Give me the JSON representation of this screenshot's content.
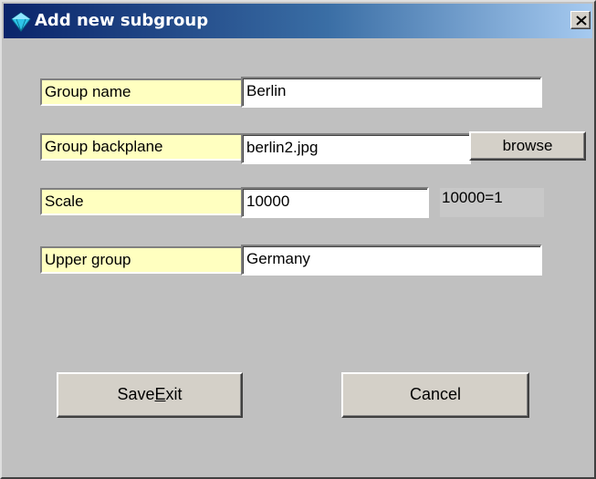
{
  "window": {
    "title": "Add new subgroup",
    "close_glyph": "✕"
  },
  "fields": {
    "group_name": {
      "label": "Group name",
      "value": "Berlin"
    },
    "group_backplane": {
      "label": "Group backplane",
      "value": "berlin2.jpg",
      "browse_label": "browse"
    },
    "scale": {
      "label": "Scale",
      "value": "10000",
      "ratio_text": "10000=1"
    },
    "upper_group": {
      "label": "Upper group",
      "value": "Germany"
    }
  },
  "buttons": {
    "save_exit": {
      "pre": "Save",
      "mnemonic": "E",
      "post": "xit"
    },
    "cancel": "Cancel"
  },
  "colors": {
    "title_gradient_start": "#0a246a",
    "title_gradient_end": "#a6caf0",
    "label_background": "#ffffc0",
    "dialog_background": "#c0c0c0"
  }
}
